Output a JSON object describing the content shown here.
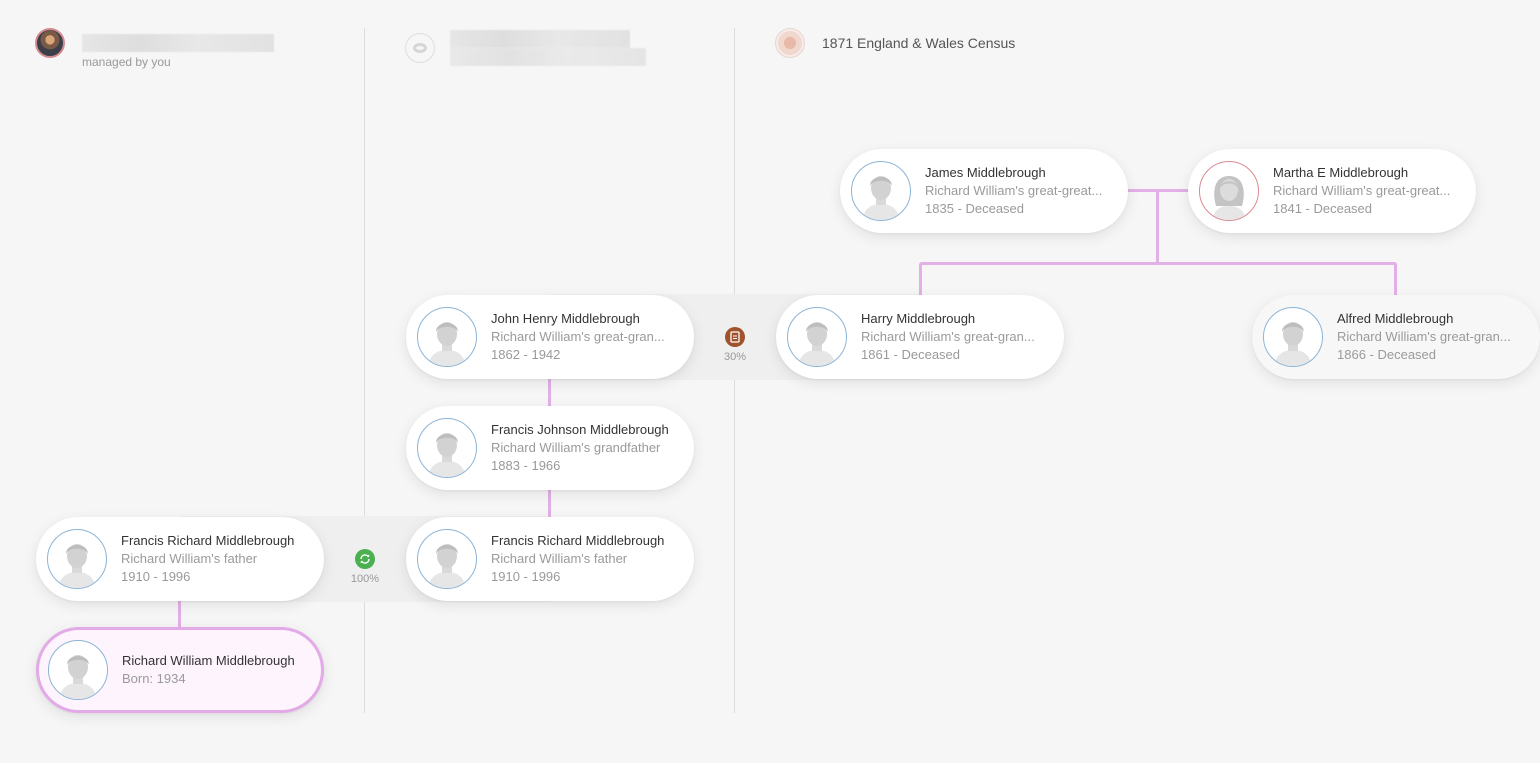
{
  "columns": [
    {
      "header": {
        "title": "",
        "subtitle": "managed by you",
        "icon": "user-photo-avatar",
        "title_obscured": true
      }
    },
    {
      "header": {
        "title": "",
        "icon": "site-logo-icon",
        "title_obscured": true
      }
    },
    {
      "header": {
        "title": "1871 England & Wales Census",
        "icon": "census-crest-icon"
      }
    }
  ],
  "colors": {
    "connector": "#e2b0e6",
    "focus_border": "#e2aae6",
    "focus_bg": "#fdf4fd",
    "male_avatar_ring": "#8db4d6",
    "female_avatar_ring": "#d98b93",
    "record_match": "#a0522d",
    "tree_match": "#4caf50"
  },
  "people": {
    "james": {
      "name": "James Middlebrough",
      "relation": "Richard William's great-great...",
      "dates": "1835 - Deceased",
      "gender": "male"
    },
    "martha": {
      "name": "Martha E Middlebrough",
      "relation": "Richard William's great-great...",
      "dates": "1841 - Deceased",
      "gender": "female"
    },
    "john_henry": {
      "name": "John Henry Middlebrough",
      "relation": "Richard William's great-gran...",
      "dates": "1862 - 1942",
      "gender": "male"
    },
    "harry": {
      "name": "Harry Middlebrough",
      "relation": "Richard William's great-gran...",
      "dates": "1861 - Deceased",
      "gender": "male"
    },
    "alfred": {
      "name": "Alfred Middlebrough",
      "relation": "Richard William's great-gran...",
      "dates": "1866 - Deceased",
      "gender": "male"
    },
    "francis_johnson": {
      "name": "Francis Johnson Middlebrough",
      "relation": "Richard William's grandfather",
      "dates": "1883 - 1966",
      "gender": "male"
    },
    "francis_richard_a": {
      "name": "Francis Richard Middlebrough",
      "relation": "Richard William's father",
      "dates": "1910 - 1996",
      "gender": "male"
    },
    "francis_richard_b": {
      "name": "Francis Richard Middlebrough",
      "relation": "Richard William's father",
      "dates": "1910 - 1996",
      "gender": "male"
    },
    "richard_william": {
      "name": "Richard William Middlebrough",
      "born": "Born: 1934",
      "gender": "male",
      "focus": true
    }
  },
  "matches": [
    {
      "between": [
        "john_henry",
        "harry"
      ],
      "icon": "record-document-icon",
      "percent": "30%"
    },
    {
      "between": [
        "francis_richard_a",
        "francis_richard_b"
      ],
      "icon": "sync-icon",
      "percent": "100%"
    }
  ]
}
